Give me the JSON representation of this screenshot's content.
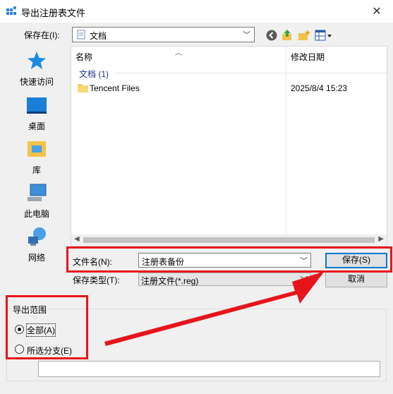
{
  "window": {
    "title": "导出注册表文件",
    "close_glyph": "✕"
  },
  "save_in": {
    "label": "保存在(I):",
    "value": "文档"
  },
  "places": [
    {
      "label": "快速访问",
      "icon": "star-icon"
    },
    {
      "label": "桌面",
      "icon": "desktop-icon"
    },
    {
      "label": "库",
      "icon": "library-icon"
    },
    {
      "label": "此电脑",
      "icon": "computer-icon"
    },
    {
      "label": "网络",
      "icon": "network-icon"
    }
  ],
  "file_list": {
    "columns": [
      "名称",
      "修改日期"
    ],
    "group": "文档 (1)",
    "rows": [
      {
        "name": "Tencent Files",
        "modified": "2025/8/4 15:23"
      }
    ]
  },
  "file_name": {
    "label": "文件名(N):",
    "value": "注册表备份"
  },
  "file_type": {
    "label": "保存类型(T):",
    "value": "注册文件(*.reg)"
  },
  "buttons": {
    "save": "保存(S)",
    "cancel": "取消"
  },
  "export_range": {
    "title": "导出范围",
    "options": [
      {
        "label": "全部(A)",
        "selected": true
      },
      {
        "label": "所选分支(E)",
        "selected": false
      }
    ],
    "branch_value": ""
  },
  "colors": {
    "highlight": "#e8141b",
    "accent": "#0078d7"
  }
}
